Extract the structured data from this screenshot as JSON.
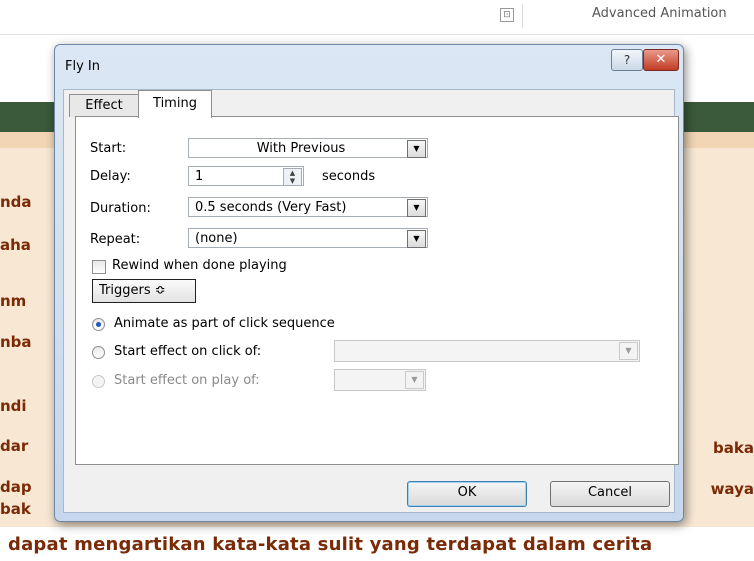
{
  "ribbon": {
    "launcher_glyph": "⊡",
    "advanced_animation": "Advanced Animation"
  },
  "slide": {
    "left_fragments": [
      "nda",
      "aha",
      "nm",
      "nba",
      "ndi",
      "dar",
      "dap",
      "bak"
    ],
    "right_fragments": [
      "baka",
      "waya"
    ],
    "bottom_line": "dapat mengartikan kata-kata sulit yang terdapat dalam cerita"
  },
  "dialog": {
    "title": "Fly In",
    "help_glyph": "?",
    "close_glyph": "✕",
    "tabs": [
      {
        "label": "Effect",
        "selected": false
      },
      {
        "label": "Timing",
        "selected": true
      }
    ],
    "start": {
      "label": "Start:",
      "value": "With Previous"
    },
    "delay": {
      "label": "Delay:",
      "value": "1",
      "unit": "seconds"
    },
    "duration": {
      "label": "Duration:",
      "value": "0.5 seconds (Very Fast)"
    },
    "repeat": {
      "label": "Repeat:",
      "value": "(none)"
    },
    "rewind": {
      "label": "Rewind when done playing",
      "checked": false
    },
    "triggers": {
      "label": "Triggers",
      "glyph": "≎"
    },
    "radios": [
      {
        "label": "Animate as part of click sequence",
        "selected": true,
        "enabled": true
      },
      {
        "label": "Start effect on click of:",
        "selected": false,
        "enabled": true
      },
      {
        "label": "Start effect on play of:",
        "selected": false,
        "enabled": false
      }
    ],
    "ok_label": "OK",
    "cancel_label": "Cancel"
  },
  "icons": {
    "dropdown": "▼",
    "spin_up": "▲",
    "spin_down": "▼"
  },
  "colors": {
    "slide_text": "#7a2a06",
    "close": "#c23b25",
    "radio_dot": "#1c5bb8"
  }
}
